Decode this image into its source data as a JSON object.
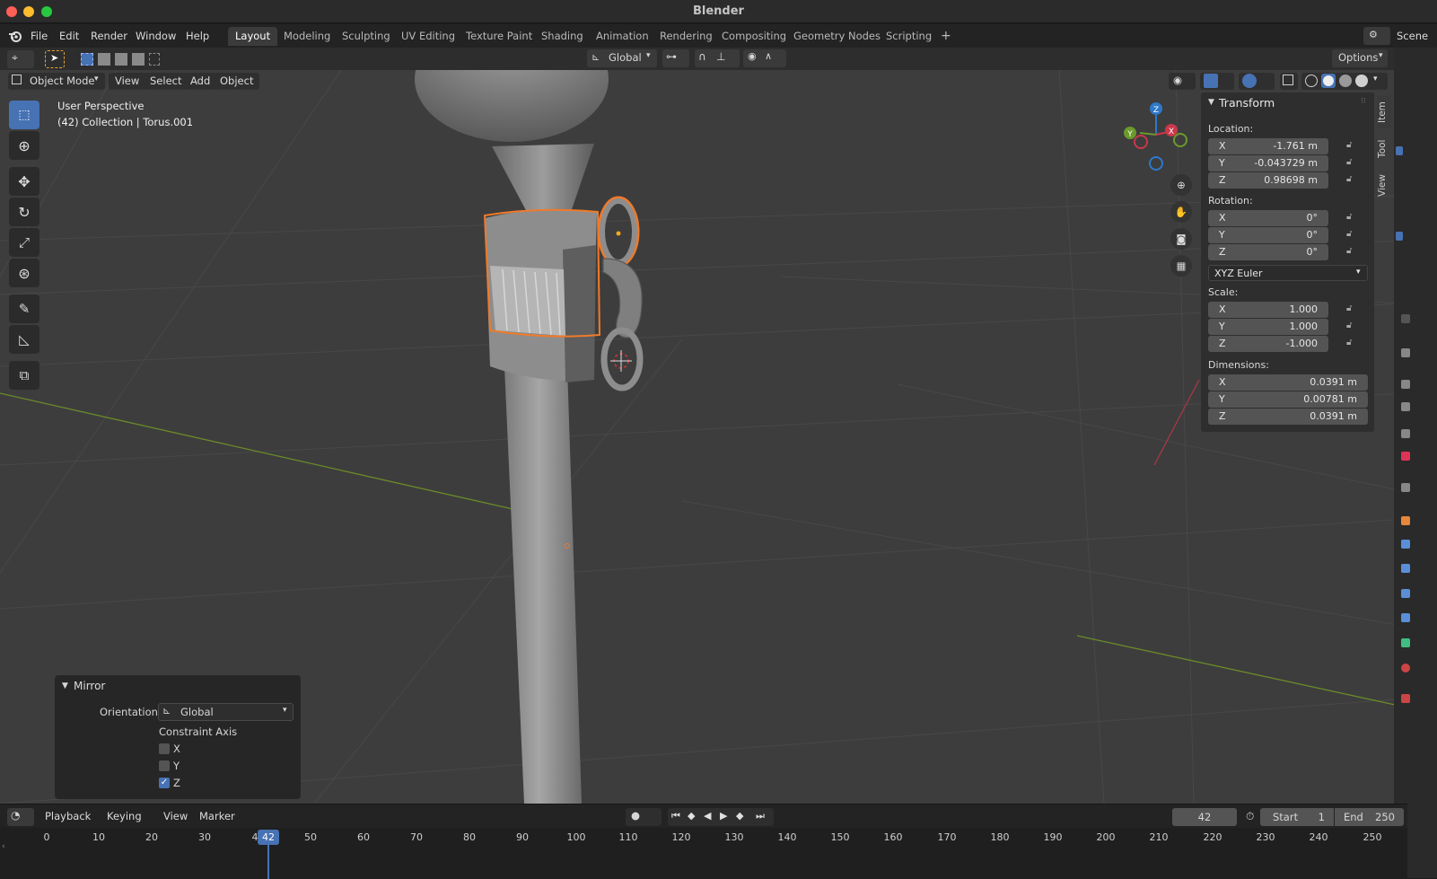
{
  "window": {
    "title": "Blender"
  },
  "menu": [
    "File",
    "Edit",
    "Render",
    "Window",
    "Help"
  ],
  "workspaces": [
    "Layout",
    "Modeling",
    "Sculpting",
    "UV Editing",
    "Texture Paint",
    "Shading",
    "Animation",
    "Rendering",
    "Compositing",
    "Geometry Nodes",
    "Scripting"
  ],
  "active_workspace": "Layout",
  "scene": "Scene",
  "header": {
    "transform_orientation": "Global",
    "options_label": "Options"
  },
  "viewport_header": {
    "mode": "Object Mode",
    "menus": [
      "View",
      "Select",
      "Add",
      "Object"
    ]
  },
  "viewport": {
    "perspective": "User Perspective",
    "collection_info": "(42) Collection | Torus.001"
  },
  "npanel": {
    "section": "Transform",
    "location_label": "Location:",
    "location": [
      {
        "axis": "X",
        "value": "-1.761 m"
      },
      {
        "axis": "Y",
        "value": "-0.043729 m"
      },
      {
        "axis": "Z",
        "value": "0.98698 m"
      }
    ],
    "rotation_label": "Rotation:",
    "rotation": [
      {
        "axis": "X",
        "value": "0°"
      },
      {
        "axis": "Y",
        "value": "0°"
      },
      {
        "axis": "Z",
        "value": "0°"
      }
    ],
    "rotation_mode": "XYZ Euler",
    "scale_label": "Scale:",
    "scale": [
      {
        "axis": "X",
        "value": "1.000"
      },
      {
        "axis": "Y",
        "value": "1.000"
      },
      {
        "axis": "Z",
        "value": "-1.000"
      }
    ],
    "dimensions_label": "Dimensions:",
    "dimensions": [
      {
        "axis": "X",
        "value": "0.0391 m"
      },
      {
        "axis": "Y",
        "value": "0.00781 m"
      },
      {
        "axis": "Z",
        "value": "0.0391 m"
      }
    ],
    "tabs": [
      "Item",
      "Tool",
      "View"
    ]
  },
  "gizmo": {
    "z": "Z",
    "y": "Y",
    "x": "X"
  },
  "mirror_panel": {
    "title": "Mirror",
    "orientation_label": "Orientation",
    "orientation_value": "Global",
    "constraint_label": "Constraint Axis",
    "axes": [
      {
        "label": "X",
        "checked": false
      },
      {
        "label": "Y",
        "checked": false
      },
      {
        "label": "Z",
        "checked": true
      }
    ]
  },
  "timeline": {
    "menus": [
      "Playback",
      "Keying",
      "View",
      "Marker"
    ],
    "current_frame": "42",
    "start_label": "Start",
    "start": "1",
    "end_label": "End",
    "end": "250",
    "ticks": [
      "0",
      "10",
      "20",
      "30",
      "4",
      "50",
      "60",
      "70",
      "80",
      "90",
      "100",
      "110",
      "120",
      "130",
      "140",
      "150",
      "160",
      "170",
      "180",
      "190",
      "200",
      "210",
      "220",
      "230",
      "240",
      "250"
    ],
    "playhead": "42"
  },
  "colors": {
    "accent": "#4772b3",
    "selection": "#f07a2a",
    "x_axis": "#c9384a",
    "y_axis": "#6a9a2b",
    "z_axis": "#2e78c9"
  }
}
